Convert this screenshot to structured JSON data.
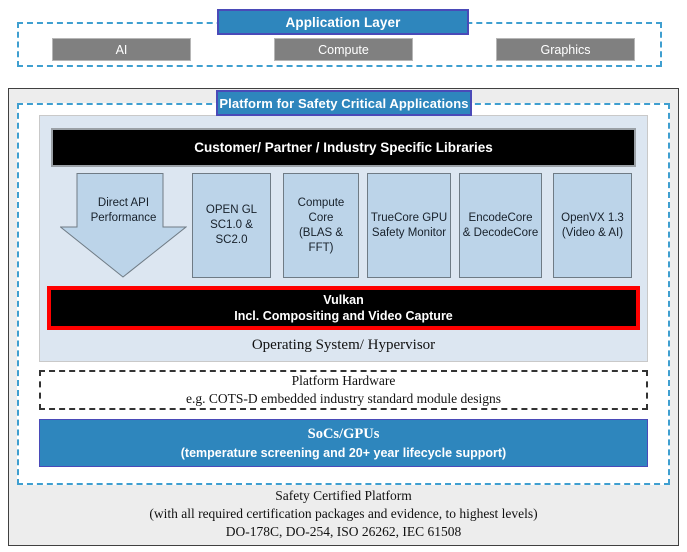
{
  "application_layer": {
    "title": "Application Layer",
    "boxes": [
      {
        "label": "AI"
      },
      {
        "label": "Compute"
      },
      {
        "label": "Graphics"
      }
    ]
  },
  "platform": {
    "title": "Platform for Safety Critical Applications",
    "libraries_bar": "Customer/ Partner / Industry Specific Libraries",
    "direct_api": {
      "line1": "Direct API",
      "line2": "Performance"
    },
    "modules": [
      {
        "line1": "OPEN GL",
        "line2": "SC1.0 & SC2.0",
        "line3": ""
      },
      {
        "line1": "Compute",
        "line2": "Core",
        "line3": "(BLAS & FFT)"
      },
      {
        "line1": "TrueCore GPU",
        "line2": "Safety Monitor",
        "line3": ""
      },
      {
        "line1": "EncodeCore",
        "line2": "& DecodeCore",
        "line3": ""
      },
      {
        "line1": "OpenVX 1.3",
        "line2": "(Video & AI)",
        "line3": ""
      }
    ],
    "vulkan": {
      "title": "Vulkan",
      "subtitle": "Incl. Compositing and Video Capture"
    },
    "operating_system": "Operating System/ Hypervisor",
    "platform_hardware": {
      "title": "Platform Hardware",
      "subtitle": "e.g. COTS-D embedded industry standard module designs"
    },
    "socs_gpus": {
      "title": "SoCs/GPUs",
      "subtitle": "(temperature screening and 20+ year lifecycle support)"
    },
    "safety_certified": {
      "line1": "Safety Certified Platform",
      "line2": "(with all required certification packages and evidence, to highest levels)",
      "line3": "DO-178C, DO-254, ISO 26262, IEC 61508"
    }
  },
  "colors": {
    "accent_blue": "#2e86bd",
    "dashed_blue": "#3f9fd0",
    "gray_box": "#808080",
    "panel_blue": "#dce6f1",
    "module_blue": "#bcd4e9",
    "alert_red": "#ff0000",
    "black_bar": "#000000",
    "frame_gray": "#ededed"
  }
}
